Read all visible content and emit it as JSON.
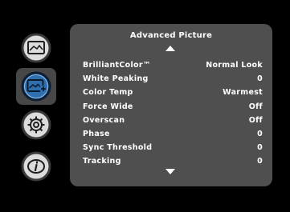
{
  "panel": {
    "title": "Advanced Picture",
    "items": [
      {
        "label": "BrilliantColor™",
        "value": "Normal Look"
      },
      {
        "label": "White Peaking",
        "value": "0"
      },
      {
        "label": "Color Temp",
        "value": "Warmest"
      },
      {
        "label": "Force Wide",
        "value": "Off"
      },
      {
        "label": "Overscan",
        "value": "Off"
      },
      {
        "label": "Phase",
        "value": "0"
      },
      {
        "label": "Sync Threshold",
        "value": "0"
      },
      {
        "label": "Tracking",
        "value": "0"
      }
    ]
  },
  "sidebar": {
    "icons": [
      {
        "name": "picture-icon",
        "selected": false
      },
      {
        "name": "advanced-picture-icon",
        "selected": true
      },
      {
        "name": "settings-gear-icon",
        "selected": false
      },
      {
        "name": "info-icon",
        "selected": false
      }
    ]
  },
  "colors": {
    "background": "#000000",
    "panel": "#4f4f4f",
    "selector": "#474747",
    "icon_fill": "#dcdcdc",
    "selected_icon_fill": "#2f6fb0",
    "text": "#ffffff"
  }
}
